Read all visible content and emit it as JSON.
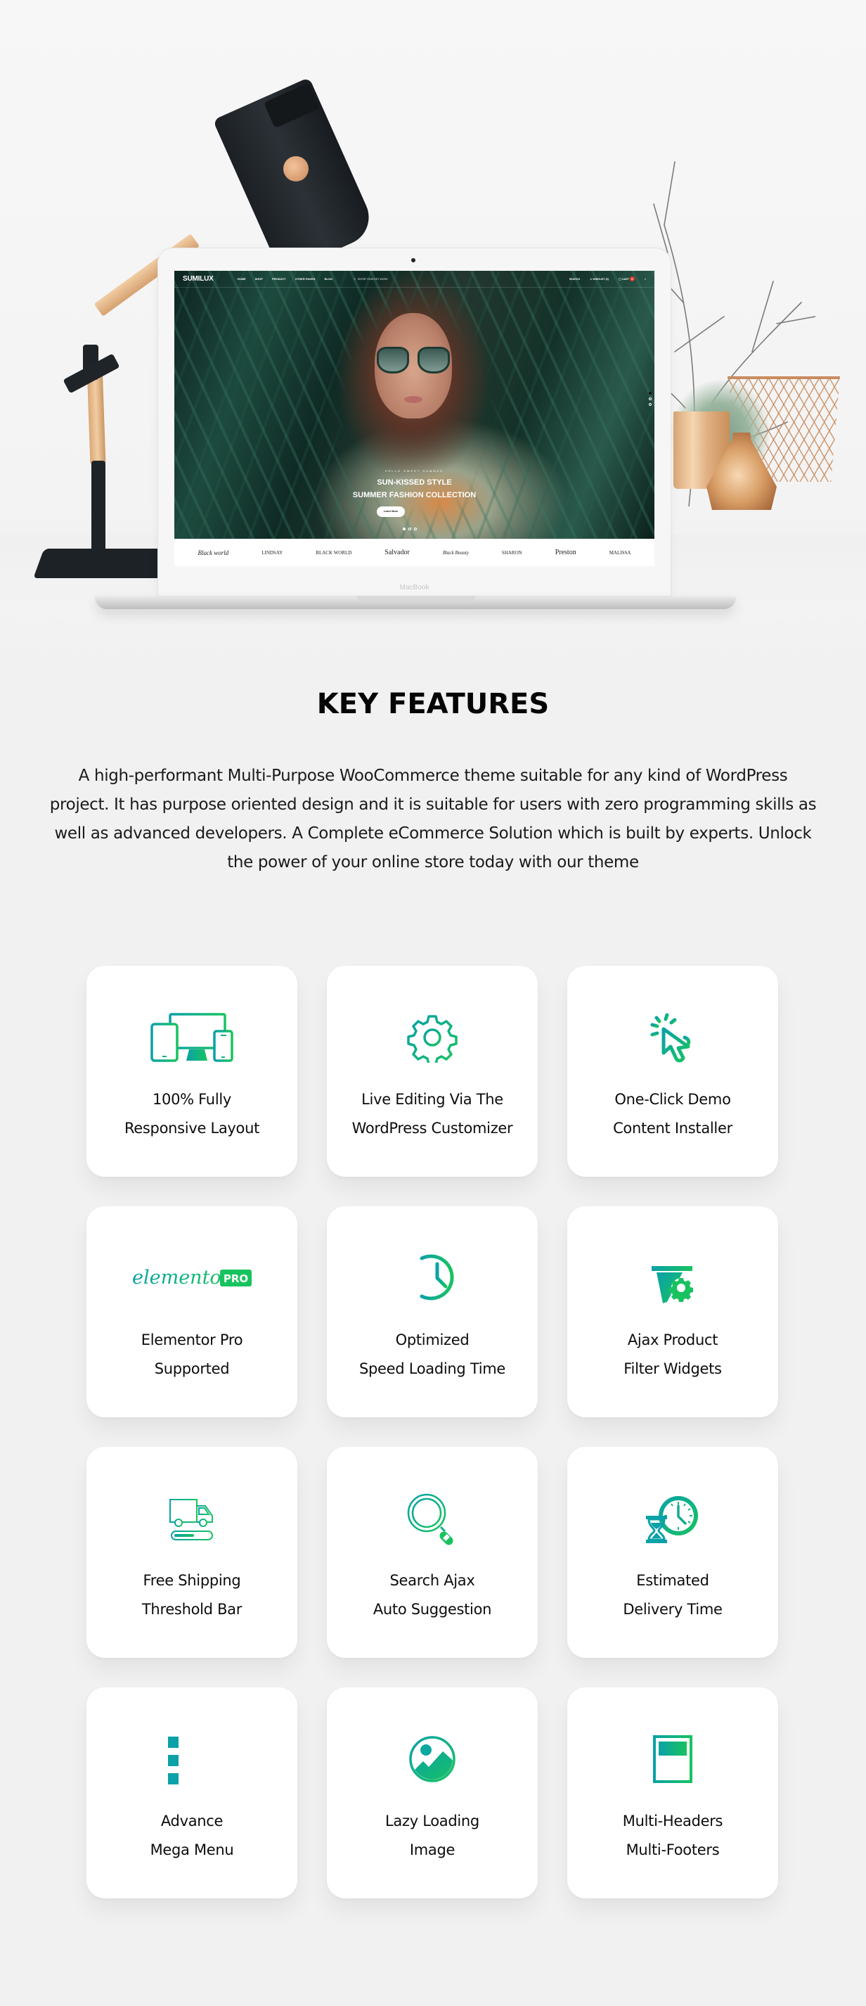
{
  "colors": {
    "gradient_start": "#0aa1a8",
    "gradient_end": "#18c35f",
    "page_bg": "#f1f1f1",
    "card_bg": "#ffffff",
    "brand_red": "#e43a2b"
  },
  "mockup": {
    "device_label": "MacBook",
    "site": {
      "logo": "SUMILUX",
      "menu": [
        "HOME",
        "SHOP",
        "PRODUCT",
        "OTHER PAGES",
        "BLOG"
      ],
      "search_placeholder": "ENTER YOUR KEY WORD",
      "right": {
        "search": "SEARCH",
        "wishlist": "WISHLIST (0)",
        "cart": "CART",
        "cart_count": "0"
      },
      "slide": {
        "kicker": "HELLO SWEET SUMMER",
        "title_line1": "SUN-KISSED STYLE",
        "title_line2": "SUMMER FASHION COLLECTION",
        "button": "Learn More"
      },
      "brands": [
        "Black world",
        "LINDSAY",
        "BLACK WORLD",
        "Salvador",
        "Black Beauty",
        "SHARON",
        "Preston",
        "MALISSA"
      ]
    }
  },
  "section": {
    "title": "KEY FEATURES",
    "description": "A high-performant Multi-Purpose WooCommerce theme suitable for any kind of WordPress project. It has purpose oriented design and it is suitable for users with zero programming skills as well as advanced developers. A Complete eCommerce Solution which is built by experts. Unlock the power of your online store today with our theme"
  },
  "features": [
    {
      "icon": "responsive-devices-icon",
      "line1": "100% Fully",
      "line2": "Responsive Layout"
    },
    {
      "icon": "gear-icon",
      "line1": "Live Editing Via The",
      "line2": "WordPress Customizer"
    },
    {
      "icon": "click-cursor-icon",
      "line1": "One-Click Demo",
      "line2": "Content Installer"
    },
    {
      "icon": "elementor-pro-logo",
      "logo_text": "elementor",
      "badge": "PRO",
      "line1": "Elementor Pro",
      "line2": "Supported"
    },
    {
      "icon": "fast-clock-icon",
      "line1": "Optimized",
      "line2": "Speed Loading Time"
    },
    {
      "icon": "filter-gear-icon",
      "line1": "Ajax Product",
      "line2": "Filter Widgets"
    },
    {
      "icon": "delivery-truck-icon",
      "line1": "Free Shipping",
      "line2": "Threshold Bar"
    },
    {
      "icon": "magnifier-icon",
      "line1": "Search Ajax",
      "line2": "Auto Suggestion"
    },
    {
      "icon": "hourglass-clock-icon",
      "line1": "Estimated",
      "line2": "Delivery Time"
    },
    {
      "icon": "mega-menu-list-icon",
      "line1": "Advance",
      "line2": "Mega Menu"
    },
    {
      "icon": "image-icon",
      "line1": "Lazy Loading",
      "line2": "Image"
    },
    {
      "icon": "page-layout-icon",
      "line1": "Multi-Headers",
      "line2": "Multi-Footers"
    }
  ]
}
